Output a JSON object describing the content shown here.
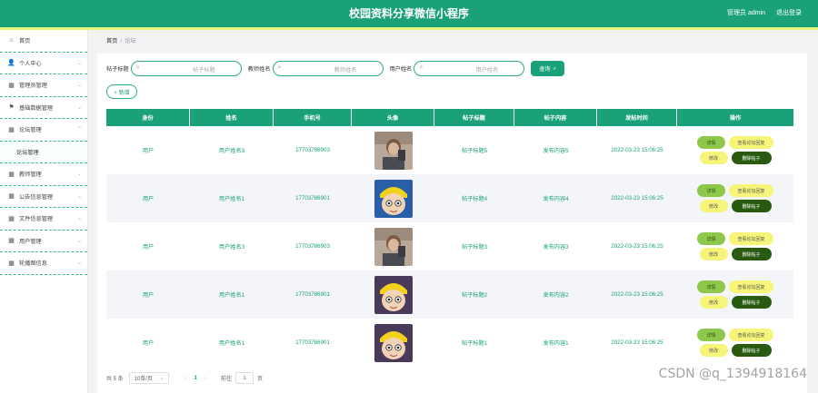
{
  "header": {
    "title": "校园资料分享微信小程序",
    "role_user": "管理员 admin",
    "logout": "退出登录"
  },
  "sidebar": {
    "items": [
      {
        "label": "首页",
        "icon": "home-icon"
      },
      {
        "label": "个人中心",
        "icon": "user-icon"
      },
      {
        "label": "管理员管理",
        "icon": "grid-icon"
      },
      {
        "label": "基础数据管理",
        "icon": "flag-icon"
      },
      {
        "label": "论坛管理",
        "icon": "grid-icon"
      },
      {
        "label": "论坛管理",
        "icon": "none",
        "sub": true
      },
      {
        "label": "教师管理",
        "icon": "grid-icon"
      },
      {
        "label": "公告信息管理",
        "icon": "grid-icon"
      },
      {
        "label": "文件信息管理",
        "icon": "grid-icon"
      },
      {
        "label": "用户管理",
        "icon": "grid-icon"
      },
      {
        "label": "轮播图信息",
        "icon": "grid-icon"
      }
    ]
  },
  "breadcrumb": {
    "home": "首页",
    "sep": "/",
    "current": "论坛"
  },
  "search": {
    "label1": "帖子标题",
    "ph1": "帖子标题",
    "label2": "教师姓名",
    "ph2": "教师姓名",
    "label3": "用户姓名",
    "ph3": "用户姓名",
    "query": "查询"
  },
  "add_button": "+ 新增",
  "table": {
    "headers": [
      "身份",
      "姓名",
      "手机号",
      "头像",
      "帖子标题",
      "帖子内容",
      "发帖时间",
      "操作"
    ],
    "rows": [
      {
        "role": "用户",
        "name": "用户姓名3",
        "phone": "17703786903",
        "title": "帖子标题5",
        "content": "发布内容5",
        "time": "2022-03-23 15:06:25",
        "avatar": "photo"
      },
      {
        "role": "用户",
        "name": "用户姓名1",
        "phone": "17703786901",
        "title": "帖子标题4",
        "content": "发布内容4",
        "time": "2022-03-23 15:06:25",
        "avatar": "cartoon"
      },
      {
        "role": "用户",
        "name": "用户姓名3",
        "phone": "17703786903",
        "title": "帖子标题3",
        "content": "发布内容3",
        "time": "2022-03-23 15:06:25",
        "avatar": "photo"
      },
      {
        "role": "用户",
        "name": "用户姓名1",
        "phone": "17703786901",
        "title": "帖子标题2",
        "content": "发布内容2",
        "time": "2022-03-23 15:06:25",
        "avatar": "cartoon"
      },
      {
        "role": "用户",
        "name": "用户姓名1",
        "phone": "17703786901",
        "title": "帖子标题1",
        "content": "发布内容1",
        "time": "2022-03-23 15:06:25",
        "avatar": "cartoon"
      }
    ],
    "ops": {
      "detail": "详情",
      "reply": "查看论坛回复",
      "edit": "修改",
      "delete": "删除帖子"
    }
  },
  "pagination": {
    "total": "共 5 条",
    "page_size": "10条/页",
    "current": "1",
    "goto": "前往",
    "goto_value": "1",
    "page_unit": "页"
  },
  "watermark": "CSDN @q_1394918164",
  "colors": {
    "primary": "#1aa179",
    "accent_line": "#e6f57a",
    "detail_btn": "#8fc74a",
    "yellow_btn": "#f6f57a",
    "dark_btn": "#285b0f"
  }
}
